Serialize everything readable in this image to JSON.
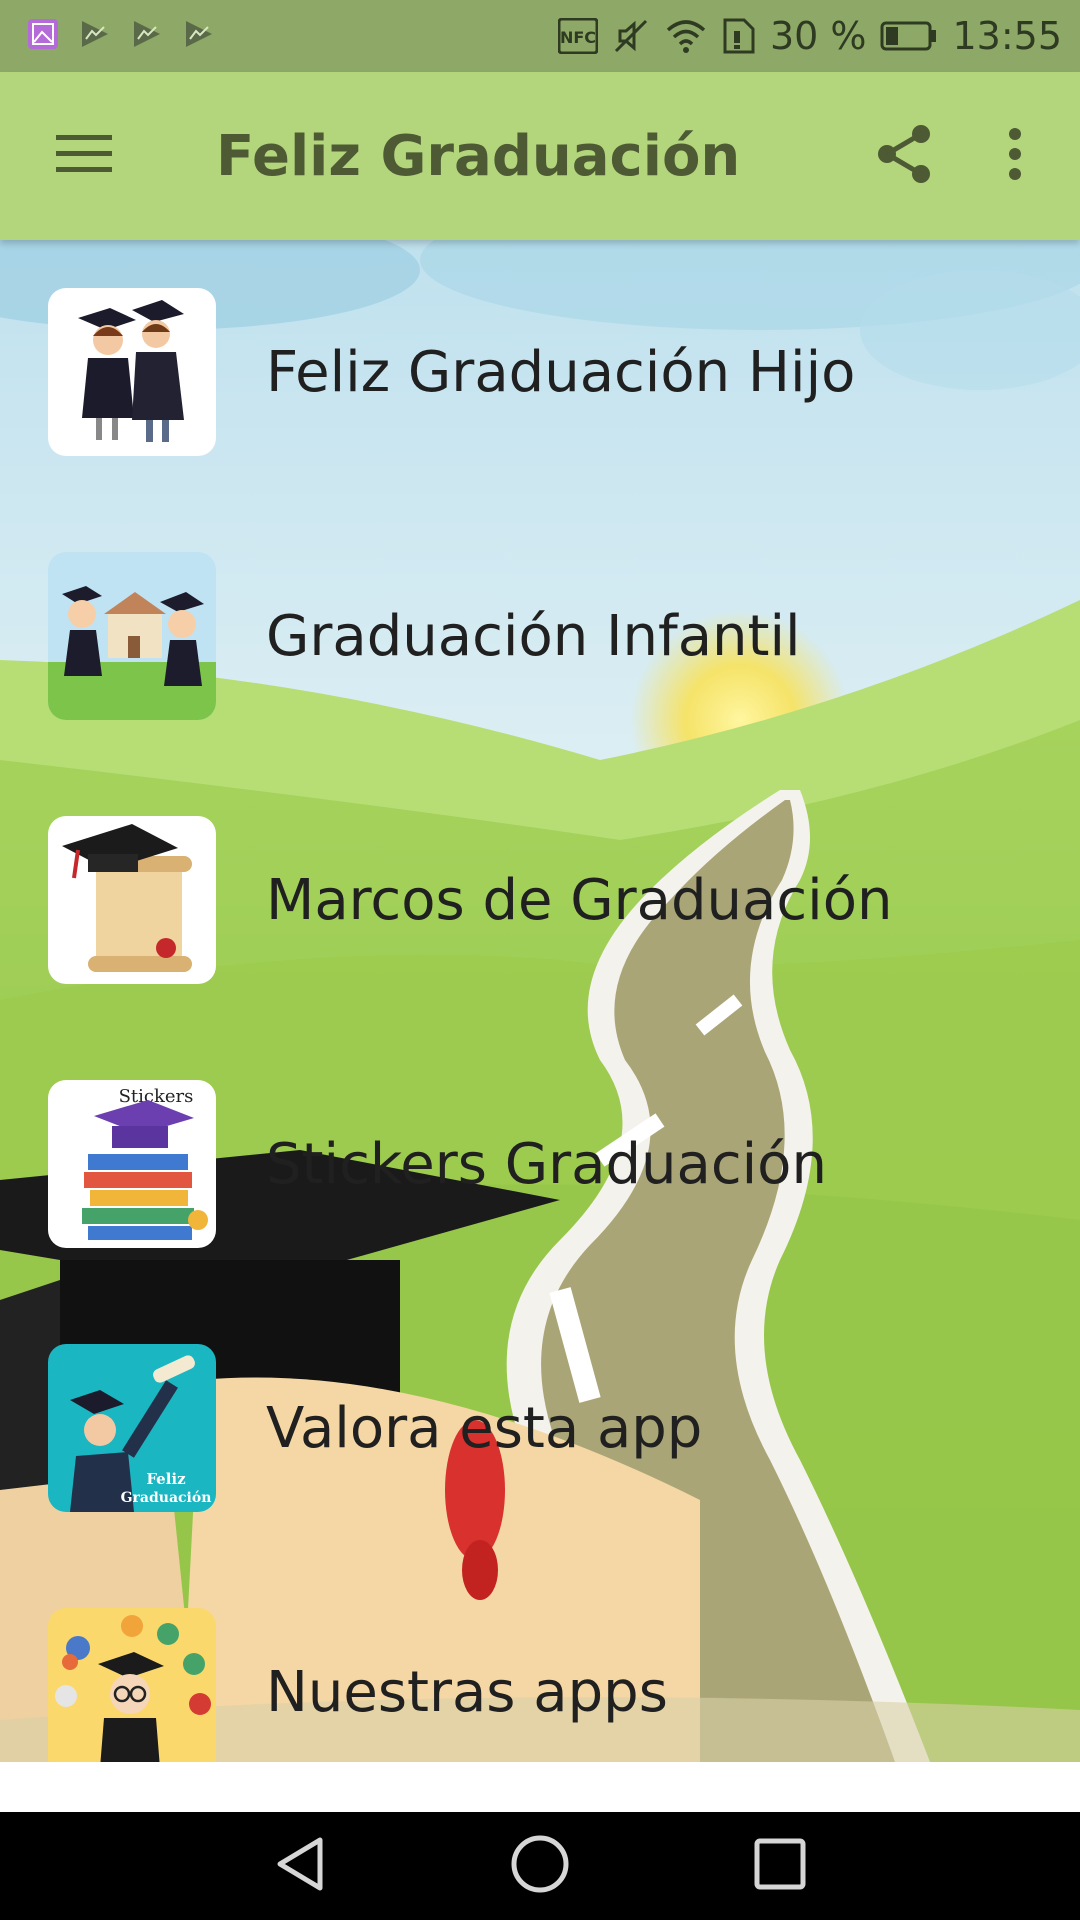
{
  "status_bar": {
    "battery_percent": "30 %",
    "time": "13:55",
    "icons": [
      "gallery-icon",
      "chart-icon",
      "chart-icon",
      "chart-icon",
      "nfc-icon",
      "mute-icon",
      "wifi-icon",
      "sim-icon",
      "battery-icon"
    ],
    "battery_level": 0.3
  },
  "app_bar": {
    "title": "Feliz Graduación",
    "menu_icon": "hamburger-icon",
    "share_icon": "share-icon",
    "more_icon": "more-vert-icon"
  },
  "menu": {
    "items": [
      {
        "label": "Feliz Graduación Hijo",
        "icon": "graduates-couple-icon"
      },
      {
        "label": "Graduación Infantil",
        "icon": "kids-graduation-icon"
      },
      {
        "label": "Marcos de Graduación",
        "icon": "diploma-cap-icon"
      },
      {
        "label": "Stickers Graduación",
        "icon": "stickers-books-icon"
      },
      {
        "label": "Valora esta app",
        "icon": "graduate-man-icon"
      },
      {
        "label": "Nuestras apps",
        "icon": "graduate-apps-icon"
      }
    ]
  },
  "thumbnails": {
    "stickers_text": "Stickers",
    "valora_text_1": "Feliz",
    "valora_text_2": "Graduación"
  },
  "nav_bar": {
    "back_icon": "back-triangle-icon",
    "home_icon": "home-circle-icon",
    "recents_icon": "recents-square-icon"
  },
  "colors": {
    "status_bar": "#8ea967",
    "app_bar": "#b3d57c",
    "title": "#4d5a34",
    "nav_bar": "#000000"
  }
}
